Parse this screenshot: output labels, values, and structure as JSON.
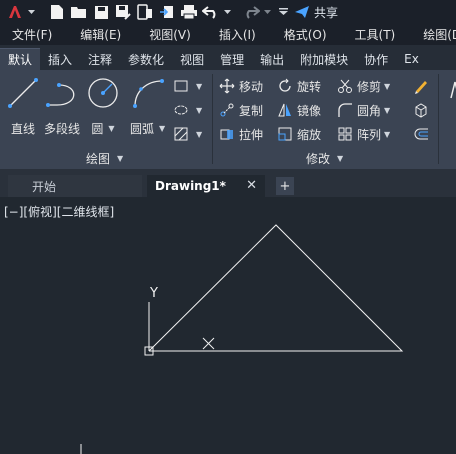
{
  "quick_access": {
    "share_label": "共享"
  },
  "menu": {
    "items": [
      "文件(F)",
      "编辑(E)",
      "视图(V)",
      "插入(I)",
      "格式(O)",
      "工具(T)",
      "绘图(D)"
    ]
  },
  "ribbon_tabs": {
    "items": [
      "默认",
      "插入",
      "注释",
      "参数化",
      "视图",
      "管理",
      "输出",
      "附加模块",
      "协作",
      "Ex"
    ],
    "active": "默认"
  },
  "draw_panel": {
    "title": "绘图",
    "line": "直线",
    "polyline": "多段线",
    "circle": "圆",
    "arc": "圆弧"
  },
  "modify_panel": {
    "title": "修改",
    "move": "移动",
    "rotate": "旋转",
    "trim": "修剪",
    "copy": "复制",
    "mirror": "镜像",
    "fillet": "圆角",
    "stretch": "拉伸",
    "scale": "缩放",
    "array": "阵列"
  },
  "document_tabs": {
    "start": "开始",
    "drawing": "Drawing1*",
    "close_glyph": "✕",
    "new_glyph": "+"
  },
  "viewport": {
    "label": "[−][俯视][二维线框]",
    "ucs_y_label": "Y"
  },
  "colors": {
    "accent_blue": "#4aa3ff",
    "logo_red": "#d9363e",
    "canvas_bg": "#212830",
    "ribbon_bg": "#3b4453"
  }
}
